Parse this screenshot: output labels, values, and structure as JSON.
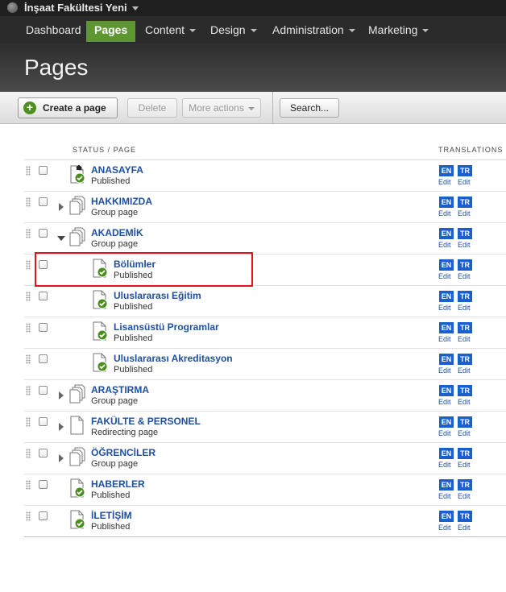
{
  "site": {
    "title": "İnşaat Fakültesi Yeni"
  },
  "nav": {
    "items": [
      {
        "label": "Dashboard",
        "active": false,
        "dropdown": false
      },
      {
        "label": "Pages",
        "active": true,
        "dropdown": false
      },
      {
        "label": "Content",
        "active": false,
        "dropdown": true
      },
      {
        "label": "Design",
        "active": false,
        "dropdown": true
      },
      {
        "label": "Administration",
        "active": false,
        "dropdown": true
      },
      {
        "label": "Marketing",
        "active": false,
        "dropdown": true
      }
    ]
  },
  "header": {
    "title": "Pages"
  },
  "toolbar": {
    "create_label": "Create a page",
    "delete_label": "Delete",
    "more_label": "More actions",
    "search_label": "Search..."
  },
  "table": {
    "col_status": "STATUS / PAGE",
    "col_translations": "TRANSLATIONS",
    "translation_codes": [
      "EN",
      "TR"
    ],
    "edit_label": "Edit",
    "rows": [
      {
        "title": "ANASAYFA",
        "status": "Published",
        "icon": "home-page-published-icon",
        "expander": "none",
        "level": 0
      },
      {
        "title": "HAKKIMIZDA",
        "status": "Group page",
        "icon": "group-page-icon",
        "expander": "collapsed",
        "level": 0
      },
      {
        "title": "AKADEMİK",
        "status": "Group page",
        "icon": "group-page-icon",
        "expander": "expanded",
        "level": 0
      },
      {
        "title": "Bölümler",
        "status": "Published",
        "icon": "page-published-icon",
        "expander": "none",
        "level": 1
      },
      {
        "title": "Uluslararası Eğitim",
        "status": "Published",
        "icon": "page-published-icon",
        "expander": "none",
        "level": 1
      },
      {
        "title": "Lisansüstü Programlar",
        "status": "Published",
        "icon": "page-published-icon",
        "expander": "none",
        "level": 1
      },
      {
        "title": "Uluslararası Akreditasyon",
        "status": "Published",
        "icon": "page-published-icon",
        "expander": "none",
        "level": 1
      },
      {
        "title": "ARAŞTIRMA",
        "status": "Group page",
        "icon": "group-page-icon",
        "expander": "collapsed",
        "level": 0
      },
      {
        "title": "FAKÜLTE & PERSONEL",
        "status": "Redirecting page",
        "icon": "redirect-page-icon",
        "expander": "collapsed",
        "level": 0
      },
      {
        "title": "ÖĞRENCİLER",
        "status": "Group page",
        "icon": "group-page-icon",
        "expander": "collapsed",
        "level": 0
      },
      {
        "title": "HABERLER",
        "status": "Published",
        "icon": "page-published-icon",
        "expander": "none",
        "level": 0
      },
      {
        "title": "İLETİŞİM",
        "status": "Published",
        "icon": "page-published-icon",
        "expander": "none",
        "level": 0
      }
    ]
  },
  "colors": {
    "accent_green": "#5e9730",
    "link_blue": "#1f4fa0",
    "translation_badge": "#1a5fcc",
    "highlight_red": "#e0141b"
  }
}
